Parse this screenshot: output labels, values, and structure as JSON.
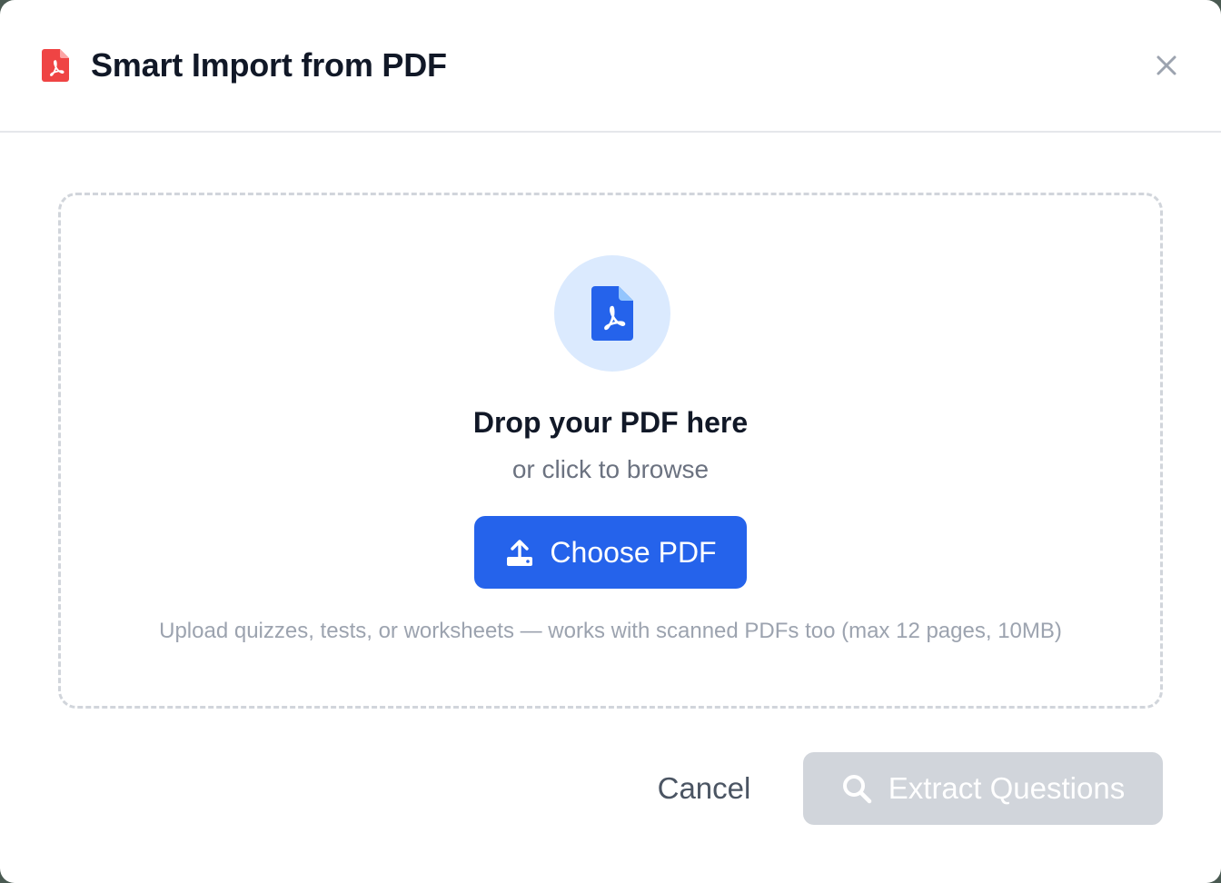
{
  "dialog": {
    "title": "Smart Import from PDF",
    "title_icon": "pdf-file-icon",
    "close_icon": "close-icon",
    "brand_red": "#ef4444"
  },
  "dropzone": {
    "icon": "pdf-file-icon",
    "title": "Drop your PDF here",
    "subtitle": "or click to browse",
    "choose_button": {
      "label": "Choose PDF",
      "icon": "upload-icon",
      "color": "#2563eb"
    },
    "hint": "Upload quizzes, tests, or worksheets — works with scanned PDFs too (max 12 pages, 10MB)"
  },
  "footer": {
    "cancel_label": "Cancel",
    "extract_button": {
      "label": "Extract Questions",
      "icon": "search-icon",
      "disabled": true,
      "color": "#d1d5db"
    }
  }
}
